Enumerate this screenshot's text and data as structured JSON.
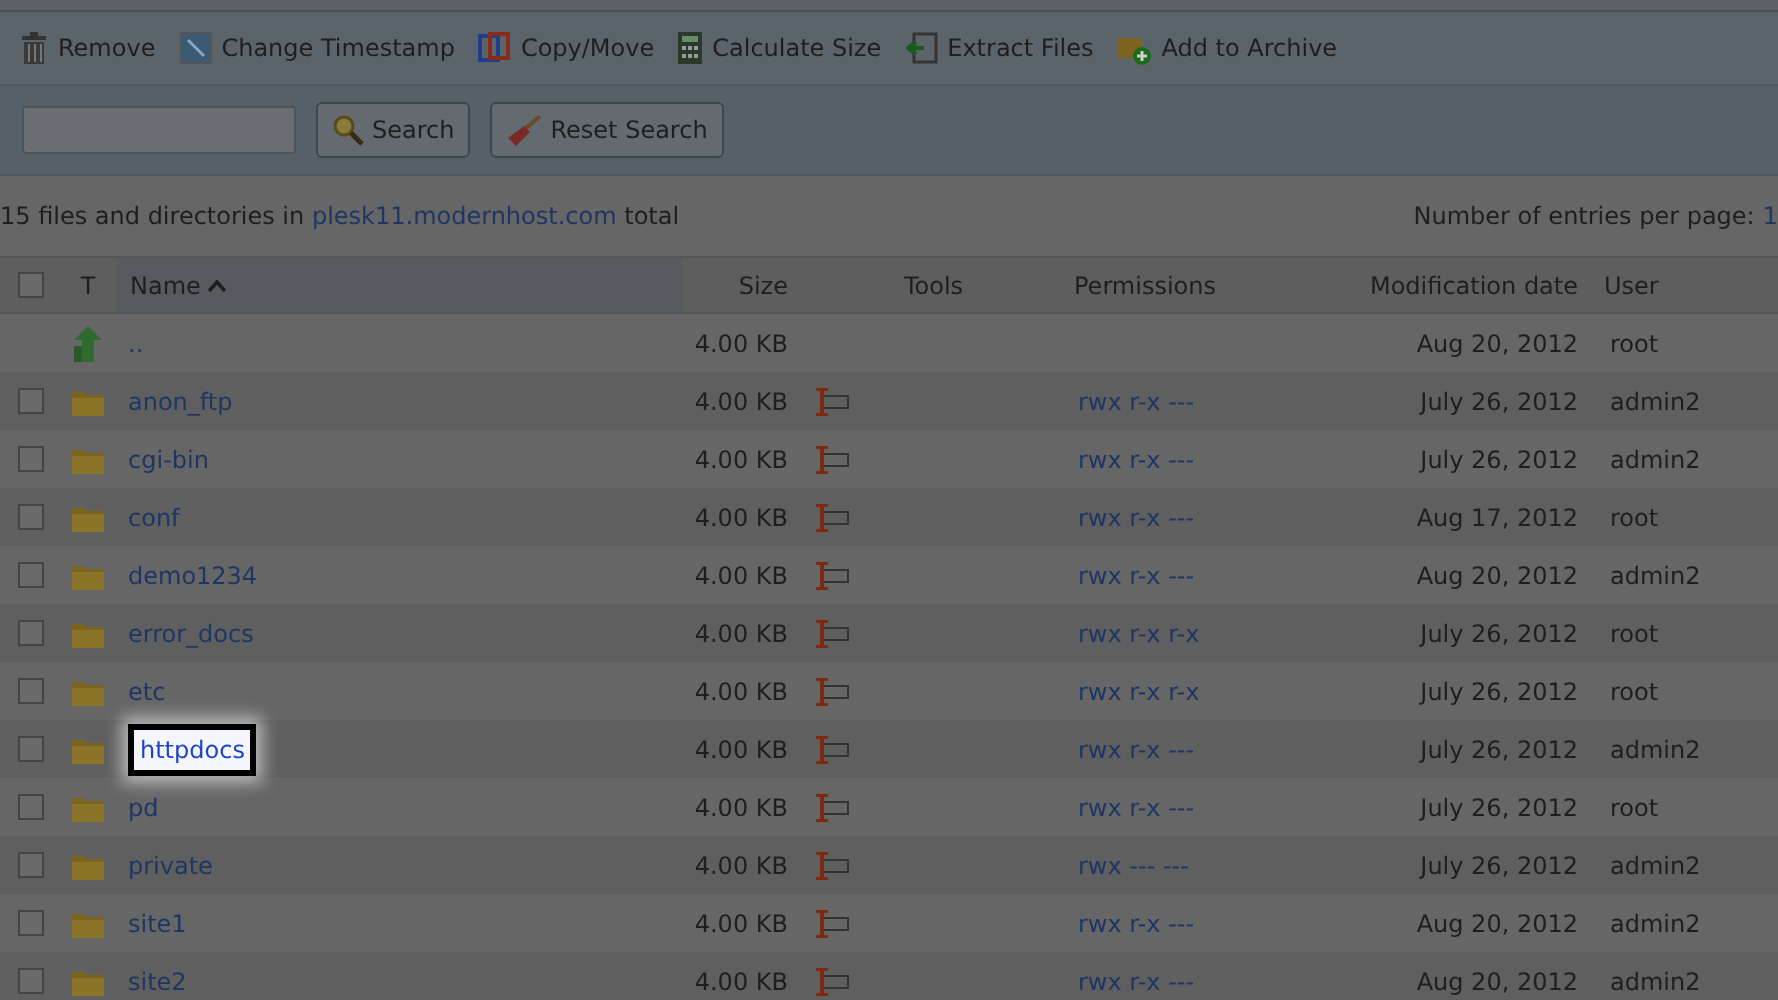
{
  "toolbar": [
    {
      "kind": "trash",
      "label": "Remove"
    },
    {
      "kind": "timestamp",
      "label": "Change Timestamp"
    },
    {
      "kind": "copy",
      "label": "Copy/Move"
    },
    {
      "kind": "calc",
      "label": "Calculate Size"
    },
    {
      "kind": "extract",
      "label": "Extract Files"
    },
    {
      "kind": "archive",
      "label": "Add to Archive"
    }
  ],
  "search": {
    "buttons": [
      {
        "kind": "search",
        "label": "Search"
      },
      {
        "kind": "reset",
        "label": "Reset Search"
      }
    ]
  },
  "summary": {
    "prefix": "15 files and directories in",
    "host": "plesk11.modernhost.com",
    "suffix": "total",
    "per_page_label": "Number of entries per page:",
    "per_page_value": "1"
  },
  "table": {
    "select_all_checked": false,
    "columns": [
      {
        "label": "T",
        "sorted": false
      },
      {
        "label": "Name",
        "sorted": true
      },
      {
        "label": "Size",
        "sorted": false
      },
      {
        "label": "Tools",
        "sorted": false
      },
      {
        "label": "Permissions",
        "sorted": false
      },
      {
        "label": "Modification date",
        "sorted": false
      },
      {
        "label": "User",
        "sorted": false
      }
    ],
    "rows": [
      {
        "kind": "parent",
        "name": "..",
        "size": "4.00 KB",
        "permissions": "",
        "date": "Aug 20, 2012",
        "user": "root",
        "highlighted": false
      },
      {
        "kind": "folder",
        "checked": false,
        "name": "anon_ftp",
        "size": "4.00 KB",
        "permissions": "rwx r-x ---",
        "date": "July 26, 2012",
        "user": "admin2",
        "highlighted": false
      },
      {
        "kind": "folder",
        "checked": false,
        "name": "cgi-bin",
        "size": "4.00 KB",
        "permissions": "rwx r-x ---",
        "date": "July 26, 2012",
        "user": "admin2",
        "highlighted": false
      },
      {
        "kind": "folder",
        "checked": false,
        "name": "conf",
        "size": "4.00 KB",
        "permissions": "rwx r-x ---",
        "date": "Aug 17, 2012",
        "user": "root",
        "highlighted": false
      },
      {
        "kind": "folder",
        "checked": false,
        "name": "demo1234",
        "size": "4.00 KB",
        "permissions": "rwx r-x ---",
        "date": "Aug 20, 2012",
        "user": "admin2",
        "highlighted": false
      },
      {
        "kind": "folder",
        "checked": false,
        "name": "error_docs",
        "size": "4.00 KB",
        "permissions": "rwx r-x r-x",
        "date": "July 26, 2012",
        "user": "root",
        "highlighted": false
      },
      {
        "kind": "folder",
        "checked": false,
        "name": "etc",
        "size": "4.00 KB",
        "permissions": "rwx r-x r-x",
        "date": "July 26, 2012",
        "user": "root",
        "highlighted": false
      },
      {
        "kind": "folder",
        "checked": false,
        "name": "httpdocs",
        "size": "4.00 KB",
        "permissions": "rwx r-x ---",
        "date": "July 26, 2012",
        "user": "admin2",
        "highlighted": true
      },
      {
        "kind": "folder",
        "checked": false,
        "name": "pd",
        "size": "4.00 KB",
        "permissions": "rwx r-x ---",
        "date": "July 26, 2012",
        "user": "root",
        "highlighted": false
      },
      {
        "kind": "folder",
        "checked": false,
        "name": "private",
        "size": "4.00 KB",
        "permissions": "rwx --- ---",
        "date": "July 26, 2012",
        "user": "admin2",
        "highlighted": false
      },
      {
        "kind": "folder",
        "checked": false,
        "name": "site1",
        "size": "4.00 KB",
        "permissions": "rwx r-x ---",
        "date": "Aug 20, 2012",
        "user": "admin2",
        "highlighted": false
      },
      {
        "kind": "folder",
        "checked": false,
        "name": "site2",
        "size": "4.00 KB",
        "permissions": "rwx r-x ---",
        "date": "Aug 20, 2012",
        "user": "admin2",
        "highlighted": false
      }
    ]
  }
}
